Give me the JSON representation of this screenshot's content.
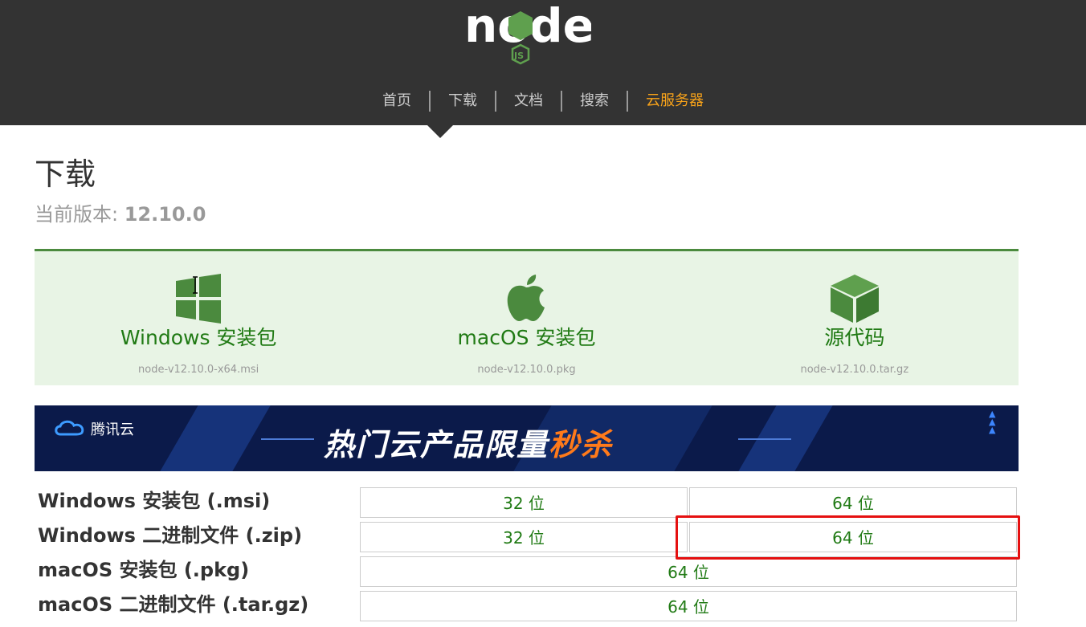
{
  "logo": {
    "text": "node",
    "badge": "JS",
    "icon": "nodejs-logo"
  },
  "nav": {
    "items": [
      "首页",
      "下载",
      "文档",
      "搜索",
      "云服务器"
    ],
    "active": "下载",
    "accent": "#f7a21a"
  },
  "page": {
    "title": "下载",
    "version_label": "当前版本: ",
    "version": "12.10.0"
  },
  "downloads": [
    {
      "icon": "windows-icon",
      "label": "Windows 安装包",
      "file": "node-v12.10.0-x64.msi"
    },
    {
      "icon": "apple-icon",
      "label": "macOS 安装包",
      "file": "node-v12.10.0.pkg"
    },
    {
      "icon": "cube-icon",
      "label": "源代码",
      "file": "node-v12.10.0.tar.gz"
    }
  ],
  "banner": {
    "brand": "腾讯云",
    "headline": "热门云产品限量",
    "hot": "秒杀"
  },
  "table": [
    {
      "label": "Windows 安装包 (.msi)",
      "cells": [
        "32 位",
        "64 位"
      ]
    },
    {
      "label": "Windows 二进制文件 (.zip)",
      "cells": [
        "32 位",
        "64 位"
      ]
    },
    {
      "label": "macOS 安装包 (.pkg)",
      "cells": [
        "64 位"
      ]
    },
    {
      "label": "macOS 二进制文件 (.tar.gz)",
      "cells": [
        "64 位"
      ]
    }
  ],
  "colors": {
    "header": "#333333",
    "green": "#207a14",
    "box_bg": "#e8f4e5",
    "highlight": "#e51010"
  }
}
